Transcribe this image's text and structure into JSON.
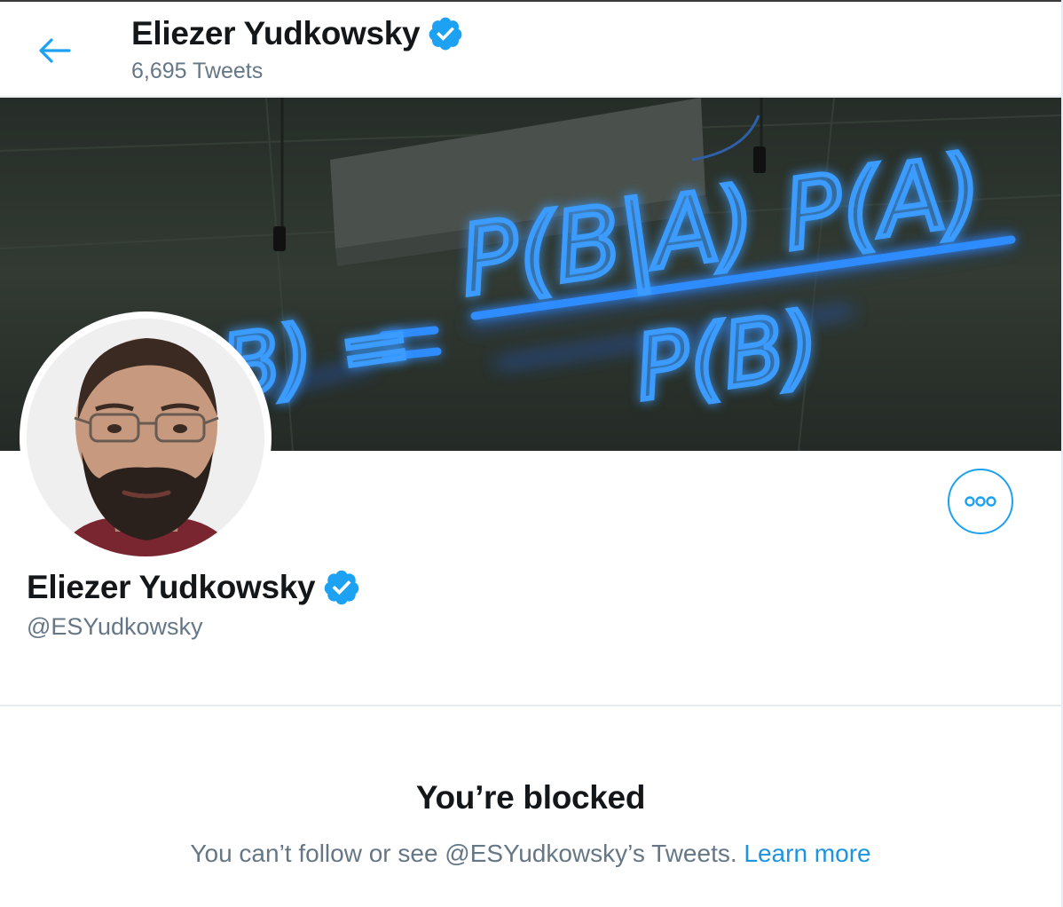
{
  "header": {
    "name": "Eliezer Yudkowsky",
    "tweet_count": "6,695 Tweets"
  },
  "banner": {
    "formula_numerator": "P(B|A) P(A)",
    "formula_left": "B) =",
    "formula_denominator": "P(B)"
  },
  "profile": {
    "name": "Eliezer Yudkowsky",
    "handle": "@ESYudkowsky"
  },
  "blocked": {
    "title": "You’re blocked",
    "message": "You can’t follow or see @ESYudkowsky’s Tweets.",
    "learn_more": "Learn more"
  },
  "colors": {
    "accent": "#1da1f2",
    "link": "#1b95e0",
    "secondary_text": "#657786",
    "neon": "#1e6bff"
  },
  "icons": {
    "back": "arrow-left-icon",
    "verified": "verified-badge-icon",
    "more": "more-horizontal-icon"
  }
}
